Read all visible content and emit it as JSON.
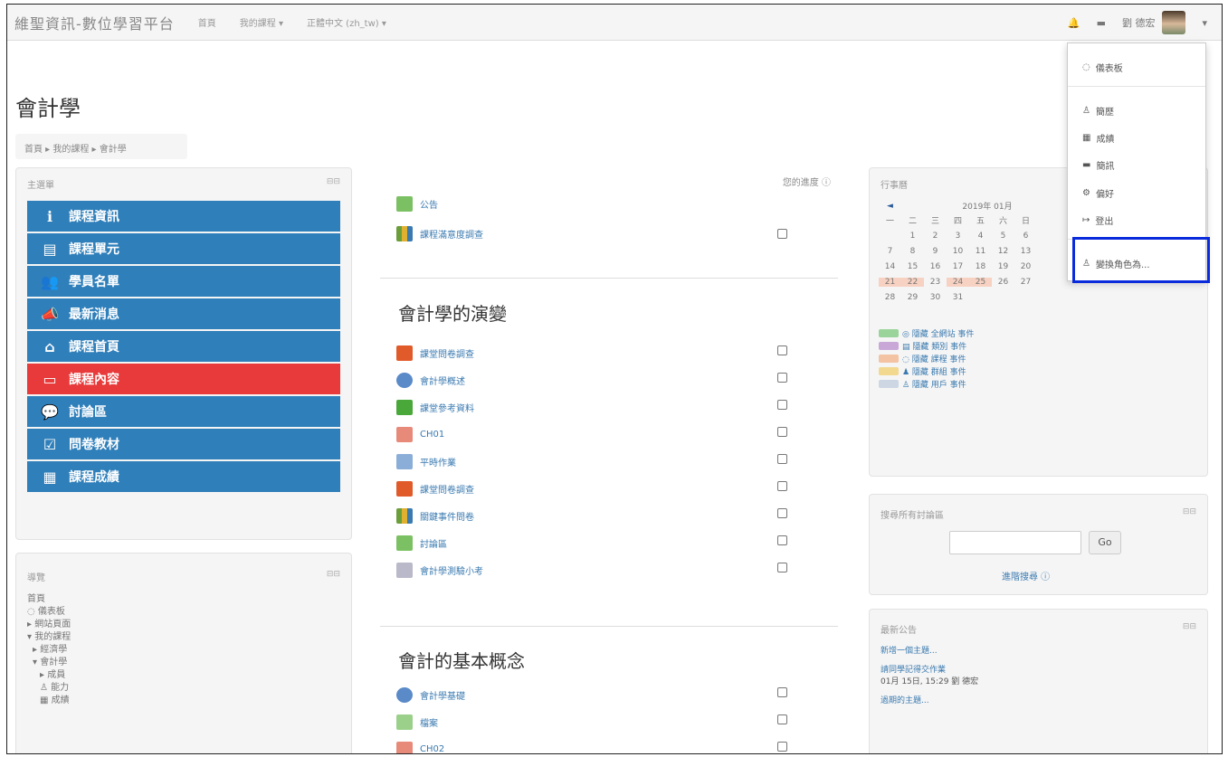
{
  "navbar": {
    "brand": "維聖資訊-數位學習平台",
    "home": "首頁",
    "my_courses": "我的課程 ▾",
    "language": "正體中文 (zh_tw) ▾",
    "user_name": "劉 德宏",
    "user_caret": "▾"
  },
  "page": {
    "title": "會計學",
    "breadcrumb": "首頁 ▸ 我的課程 ▸ 會計學"
  },
  "main_menu": {
    "title": "主選單",
    "controls": "⊟⊟",
    "items": [
      {
        "icon": "ℹ",
        "label": "課程資訊"
      },
      {
        "icon": "▤",
        "label": "課程單元"
      },
      {
        "icon": "👥",
        "label": "學員名單"
      },
      {
        "icon": "📣",
        "label": "最新消息"
      },
      {
        "icon": "⌂",
        "label": "課程首頁"
      },
      {
        "icon": "▭",
        "label": "課程內容"
      },
      {
        "icon": "💬",
        "label": "討論區"
      },
      {
        "icon": "☑",
        "label": "問卷教材"
      },
      {
        "icon": "▦",
        "label": "課程成績"
      }
    ]
  },
  "navigation": {
    "title": "導覽",
    "controls": "⊟⊟",
    "items": [
      "首頁",
      "◌ 儀表板",
      "▸ 網站頁面",
      "▾ 我的課程",
      "  ▸ 經濟學",
      "  ▾ 會計學",
      "    ▸ 成員",
      "    ♙ 能力",
      "    ▦ 成績"
    ]
  },
  "course": {
    "progress_label": "您的進度 ⓘ",
    "top_items": [
      {
        "label": "公告"
      },
      {
        "label": "課程滿意度調查"
      }
    ],
    "section1_title": "會計學的演變",
    "section1_items": [
      {
        "label": "課堂問卷調查"
      },
      {
        "label": "會計學概述"
      },
      {
        "label": "課堂參考資料"
      },
      {
        "label": "CH01"
      },
      {
        "label": "平時作業"
      },
      {
        "label": "課堂問卷調查"
      },
      {
        "label": "關鍵事件問卷"
      },
      {
        "label": "討論區"
      },
      {
        "label": "會計學測驗小考"
      }
    ],
    "section2_title": "會計的基本概念",
    "section2_items": [
      {
        "label": "會計學基礎"
      },
      {
        "label": "檔案"
      },
      {
        "label": "CH02"
      }
    ]
  },
  "calendar": {
    "title": "行事曆",
    "month": "2019年 01月",
    "prev": "◄",
    "weekdays": [
      "一",
      "二",
      "三",
      "四",
      "五",
      "六",
      "日"
    ],
    "weeks": [
      [
        "",
        "1",
        "2",
        "3",
        "4",
        "5",
        "6"
      ],
      [
        "7",
        "8",
        "9",
        "10",
        "11",
        "12",
        "13"
      ],
      [
        "14",
        "15",
        "16",
        "17",
        "18",
        "19",
        "20"
      ],
      [
        "21",
        "22",
        "23",
        "24",
        "25",
        "26",
        "27"
      ],
      [
        "28",
        "29",
        "30",
        "31",
        "",
        "",
        ""
      ]
    ],
    "events": [
      "◎ 隱藏 全網站 事件",
      "▤ 隱藏 類別 事件",
      "◌ 隱藏 課程 事件",
      "♟ 隱藏 群組 事件",
      "♙ 隱藏 用戶 事件"
    ]
  },
  "forum_search": {
    "title": "搜尋所有討論區",
    "controls": "⊟⊟",
    "go": "Go",
    "advanced": "進階搜尋 ⓘ"
  },
  "news": {
    "title": "最新公告",
    "controls": "⊟⊟",
    "add": "新增一個主題...",
    "post_title": "請同學記得交作業",
    "post_meta": "01月 15日, 15:29 劉 德宏",
    "older": "過期的主題..."
  },
  "user_menu": {
    "items": [
      {
        "icon": "◌",
        "label": "儀表板"
      },
      {
        "icon": "♙",
        "label": "簡歷"
      },
      {
        "icon": "▦",
        "label": "成績"
      },
      {
        "icon": "▬",
        "label": "簡訊"
      },
      {
        "icon": "⚙",
        "label": "偏好"
      },
      {
        "icon": "↦",
        "label": "登出"
      },
      {
        "icon": "♙",
        "label": "變換角色為..."
      }
    ]
  }
}
